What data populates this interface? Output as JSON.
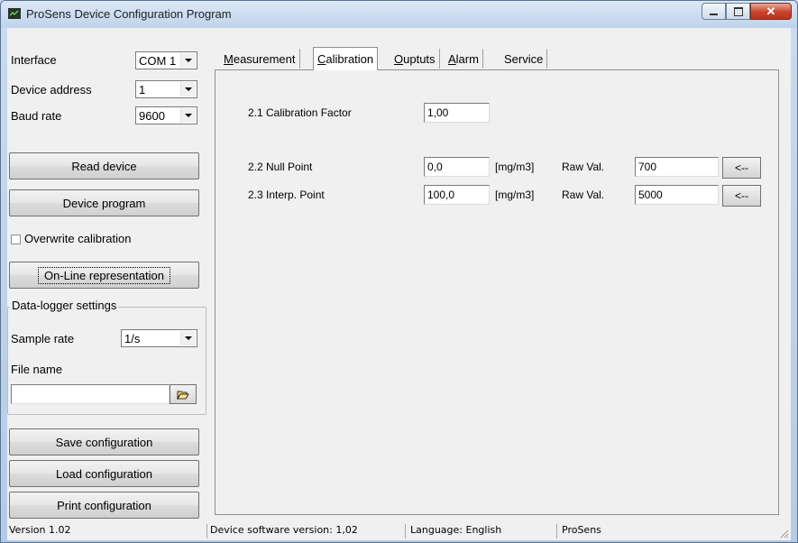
{
  "window": {
    "title": "ProSens Device Configuration Program"
  },
  "left": {
    "interface_label": "Interface",
    "interface_value": "COM 1",
    "address_label": "Device address",
    "address_value": "1",
    "baud_label": "Baud rate",
    "baud_value": "9600",
    "read_device": "Read device",
    "device_program": "Device program",
    "overwrite_calibration": "Overwrite calibration",
    "online_representation": "On-Line representation",
    "datalogger_title": "Data-logger settings",
    "sample_rate_label": "Sample rate",
    "sample_rate_value": "1/s",
    "file_name_label": "File name",
    "file_name_value": "",
    "save_configuration": "Save configuration",
    "load_configuration": "Load configuration",
    "print_configuration": "Print configuration"
  },
  "tabs": [
    {
      "label": "Measurement",
      "accel": "M",
      "rest": "easurement"
    },
    {
      "label": "Calibration",
      "accel": "C",
      "rest": "alibration"
    },
    {
      "label": "Ouptuts",
      "accel": "O",
      "rest": "uptuts"
    },
    {
      "label": "Alarm",
      "accel": "A",
      "rest": "larm"
    },
    {
      "label": "Service"
    }
  ],
  "calibration": {
    "factor_label": "2.1 Calibration Factor",
    "factor_value": "1,00",
    "null_label": "2.2  Null Point",
    "null_value": "0,0",
    "null_unit": "[mg/m3]",
    "null_raw_label": "Raw Val.",
    "null_raw_value": "700",
    "interp_label": "2.3  Interp. Point",
    "interp_value": "100,0",
    "interp_unit": "[mg/m3]",
    "interp_raw_label": "Raw Val.",
    "interp_raw_value": "5000",
    "arrow_label": "<--"
  },
  "status": {
    "version": "Version 1.02",
    "device_sw": "Device software version: 1,02",
    "language": "Language: English",
    "brand": "ProSens"
  }
}
